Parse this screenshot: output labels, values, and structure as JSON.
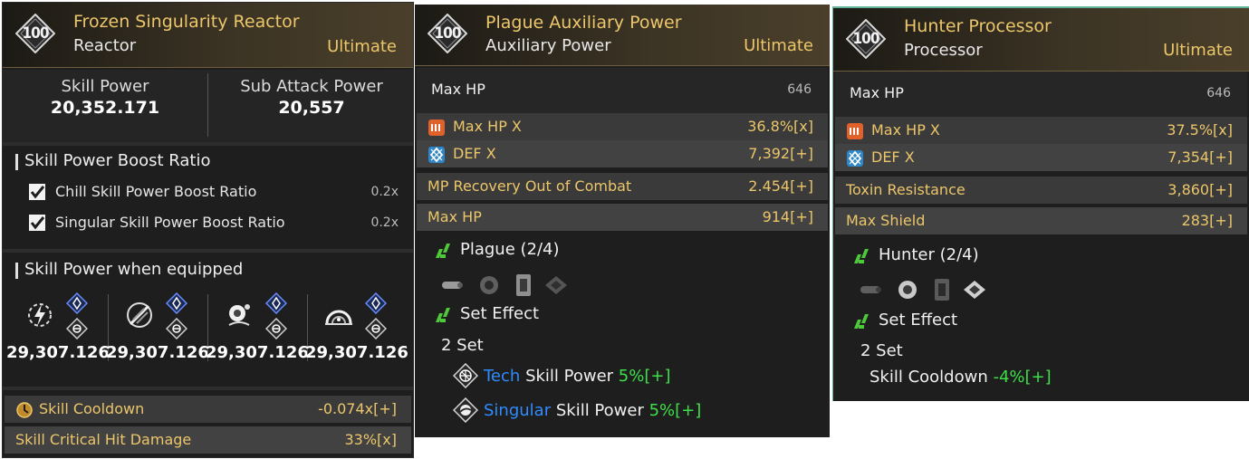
{
  "panels": {
    "reactor": {
      "level": "100",
      "name": "Frozen Singularity Reactor",
      "type": "Reactor",
      "tier": "Ultimate",
      "skill_power_label": "Skill Power",
      "skill_power_value": "20,352.171",
      "sub_attack_label": "Sub Attack Power",
      "sub_attack_value": "20,557",
      "boost_title": "Skill Power Boost Ratio",
      "boosts": [
        {
          "label": "Chill Skill Power Boost Ratio",
          "value": "0.2x"
        },
        {
          "label": "Singular Skill Power Boost Ratio",
          "value": "0.2x"
        }
      ],
      "equipped_title": "Skill Power when equipped",
      "equipped": [
        {
          "icon": "lightning-skill-icon",
          "value": "29,307.126"
        },
        {
          "icon": "crossed-blades-skill-icon",
          "value": "29,307.126"
        },
        {
          "icon": "grenade-skill-icon",
          "value": "29,307.126"
        },
        {
          "icon": "dome-skill-icon",
          "value": "29,307.126"
        }
      ],
      "stats": [
        {
          "label": "Skill Cooldown",
          "value": "-0.074x[+]",
          "icon": "cooldown-icon"
        },
        {
          "label": "Skill Critical Hit Damage",
          "value": "33%[x]"
        }
      ]
    },
    "aux": {
      "level": "100",
      "name": "Plague Auxiliary Power",
      "type": "Auxiliary Power",
      "tier": "Ultimate",
      "base_label": "Max HP",
      "base_value": "646",
      "core_stats": [
        {
          "label": "Max HP X",
          "value": "36.8%[x]",
          "icon": "hp-core-icon"
        },
        {
          "label": "DEF X",
          "value": "7,392[+]",
          "icon": "def-core-icon"
        }
      ],
      "sub_stats": [
        {
          "label": "MP Recovery Out of Combat",
          "value": "2.454[+]"
        },
        {
          "label": "Max HP",
          "value": "914[+]"
        }
      ],
      "set_name": "Plague (2/4)",
      "set_pieces": [
        "auxiliary-power-icon",
        "sensor-icon",
        "memory-icon",
        "processor-icon"
      ],
      "set_effect_title": "Set Effect",
      "set_count": "2 Set",
      "bonuses": [
        {
          "element": "Tech",
          "text": "Skill Power",
          "value": "5%[+]",
          "icon": "tech-attribute-icon"
        },
        {
          "element": "Singular",
          "text": "Skill Power",
          "value": "5%[+]",
          "icon": "singular-attribute-icon"
        }
      ]
    },
    "processor": {
      "level": "100",
      "name": "Hunter Processor",
      "type": "Processor",
      "tier": "Ultimate",
      "base_label": "Max HP",
      "base_value": "646",
      "core_stats": [
        {
          "label": "Max HP X",
          "value": "37.5%[x]",
          "icon": "hp-core-icon"
        },
        {
          "label": "DEF X",
          "value": "7,354[+]",
          "icon": "def-core-icon"
        }
      ],
      "sub_stats": [
        {
          "label": "Toxin Resistance",
          "value": "3,860[+]"
        },
        {
          "label": "Max Shield",
          "value": "283[+]"
        }
      ],
      "set_name": "Hunter (2/4)",
      "set_pieces": [
        "auxiliary-power-icon",
        "sensor-icon",
        "memory-icon",
        "processor-icon"
      ],
      "set_effect_title": "Set Effect",
      "set_count": "2 Set",
      "bonus_label": "Skill Cooldown",
      "bonus_value": "-4%[+]"
    }
  },
  "colors": {
    "gold": "#ecc66a",
    "green": "#3ee04a",
    "blue": "#2f8cff",
    "panel_bg": "#1e1e1e"
  }
}
